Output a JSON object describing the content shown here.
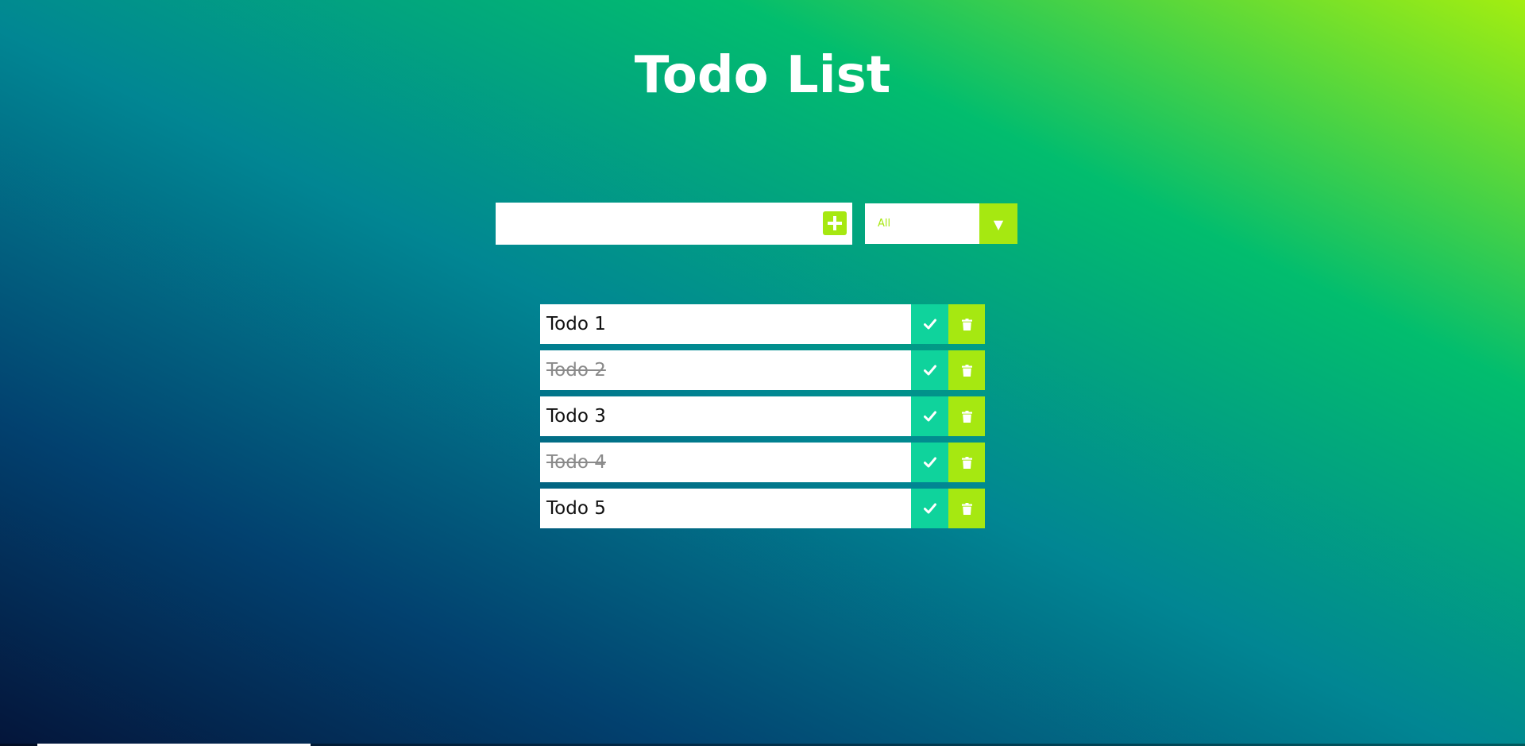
{
  "header": {
    "title": "Todo List"
  },
  "form": {
    "input_value": "",
    "input_placeholder": "",
    "add_icon": "plus-square-icon",
    "filter": {
      "selected": "All",
      "arrow_icon": "caret-down-icon"
    }
  },
  "todos": [
    {
      "text": "Todo 1",
      "completed": false
    },
    {
      "text": "Todo 2",
      "completed": true
    },
    {
      "text": "Todo 3",
      "completed": false
    },
    {
      "text": "Todo 4",
      "completed": true
    },
    {
      "text": "Todo 5",
      "completed": false
    }
  ],
  "icons": {
    "complete": "check-icon",
    "delete": "trash-icon"
  },
  "colors": {
    "accent": "#a6e811",
    "complete_button": "#0fd39c",
    "title_text": "#ffffff",
    "completed_text": "#8a8a8a"
  }
}
